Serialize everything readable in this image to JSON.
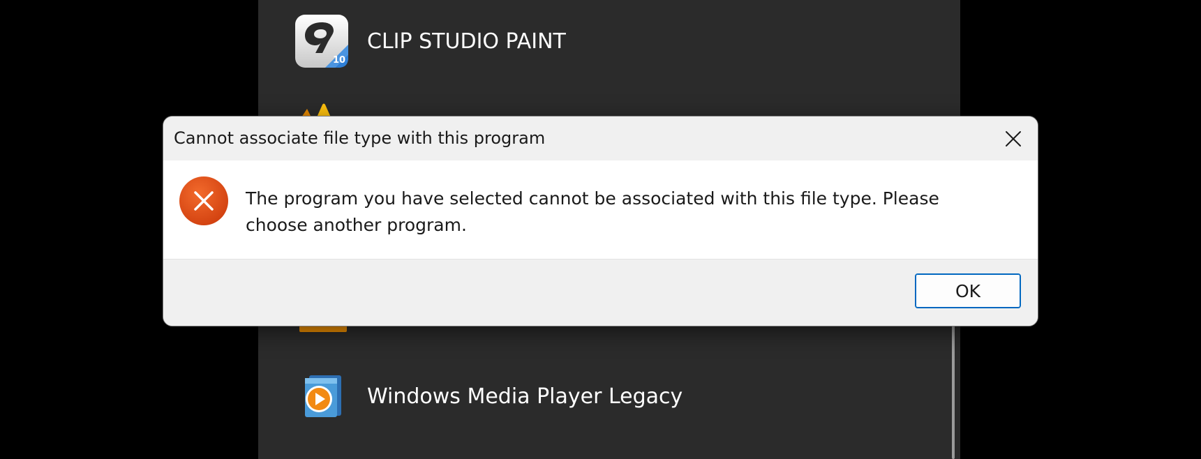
{
  "background_apps": {
    "items": [
      {
        "label": "CLIP STUDIO PAINT",
        "icon": "clip-studio-paint-icon"
      },
      {
        "label": "",
        "icon": "vlc-icon"
      },
      {
        "label": "Windows Media Player Legacy",
        "icon": "windows-media-player-icon"
      }
    ]
  },
  "dialog": {
    "title": "Cannot associate file type with this program",
    "close_icon": "close-icon",
    "error_icon": "error-icon",
    "message": "The program you have selected cannot be associated with this file type. Please choose another program.",
    "ok_label": "OK"
  },
  "colors": {
    "screen_background": "#000000",
    "panel_background": "#2b2b2b",
    "dialog_background": "#f0f0f0",
    "dialog_body": "#ffffff",
    "error_red": "#e04a12",
    "accent_blue": "#0067c0"
  }
}
